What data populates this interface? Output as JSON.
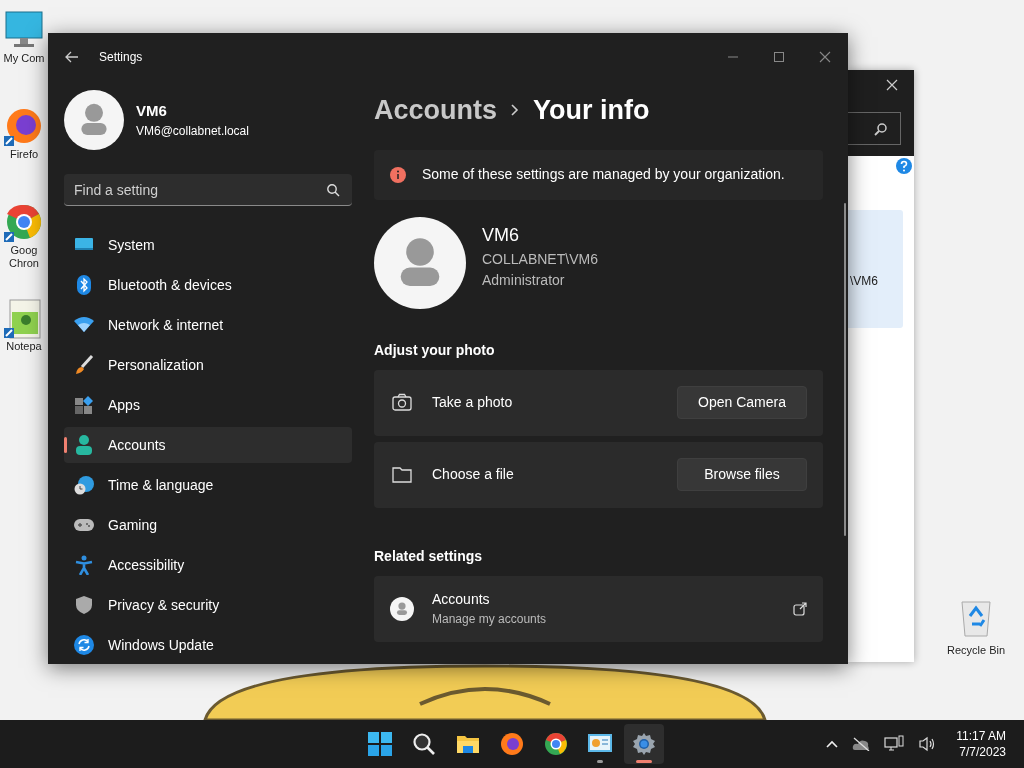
{
  "desktop_icons": [
    {
      "kind": "computer",
      "label_lines": [
        "My Com"
      ]
    },
    {
      "kind": "firefox",
      "label_lines": [
        "Firefo"
      ]
    },
    {
      "kind": "chrome",
      "label_lines": [
        "Goog",
        "Chron"
      ]
    },
    {
      "kind": "notepad",
      "label_lines": [
        "Notepa"
      ]
    }
  ],
  "recycle_bin": {
    "label": "Recycle Bin"
  },
  "background_window": {
    "panel_text": "\\VM6"
  },
  "settings": {
    "window": {
      "title": "Settings"
    },
    "account": {
      "name": "VM6",
      "email": "VM6@collabnet.local"
    },
    "search": {
      "placeholder": "Find a setting"
    },
    "nav_items": [
      {
        "kind": "system",
        "label": "System",
        "selected": false
      },
      {
        "kind": "bluetooth",
        "label": "Bluetooth & devices",
        "selected": false
      },
      {
        "kind": "network",
        "label": "Network & internet",
        "selected": false
      },
      {
        "kind": "personalization",
        "label": "Personalization",
        "selected": false
      },
      {
        "kind": "apps",
        "label": "Apps",
        "selected": false
      },
      {
        "kind": "accounts",
        "label": "Accounts",
        "selected": true
      },
      {
        "kind": "time",
        "label": "Time & language",
        "selected": false
      },
      {
        "kind": "gaming",
        "label": "Gaming",
        "selected": false
      },
      {
        "kind": "accessibility",
        "label": "Accessibility",
        "selected": false
      },
      {
        "kind": "privacy",
        "label": "Privacy & security",
        "selected": false
      },
      {
        "kind": "update",
        "label": "Windows Update",
        "selected": false
      }
    ],
    "breadcrumb": [
      "Accounts",
      "Your info"
    ],
    "info_bar": {
      "text": "Some of these settings are managed by your organization."
    },
    "profile": {
      "name": "VM6",
      "domain_user": "COLLABNET\\VM6",
      "role": "Administrator"
    },
    "photo_section": {
      "heading": "Adjust your photo",
      "options": [
        {
          "kind": "camera",
          "label": "Take a photo",
          "button": "Open Camera"
        },
        {
          "kind": "folder",
          "label": "Choose a file",
          "button": "Browse files"
        }
      ]
    },
    "related_section": {
      "heading": "Related settings",
      "links": [
        {
          "title": "Accounts",
          "subtitle": "Manage my accounts"
        }
      ]
    }
  },
  "taskbar": {
    "apps": [
      {
        "kind": "start",
        "running": false,
        "selected": false
      },
      {
        "kind": "search",
        "running": false,
        "selected": false
      },
      {
        "kind": "explorer",
        "running": false,
        "selected": false
      },
      {
        "kind": "firefox",
        "running": false,
        "selected": false
      },
      {
        "kind": "chrome",
        "running": false,
        "selected": false
      },
      {
        "kind": "control-panel",
        "running": true,
        "selected": false
      },
      {
        "kind": "settings",
        "running": true,
        "selected": true
      }
    ],
    "time": "11:17 AM",
    "date": "7/7/2023"
  }
}
